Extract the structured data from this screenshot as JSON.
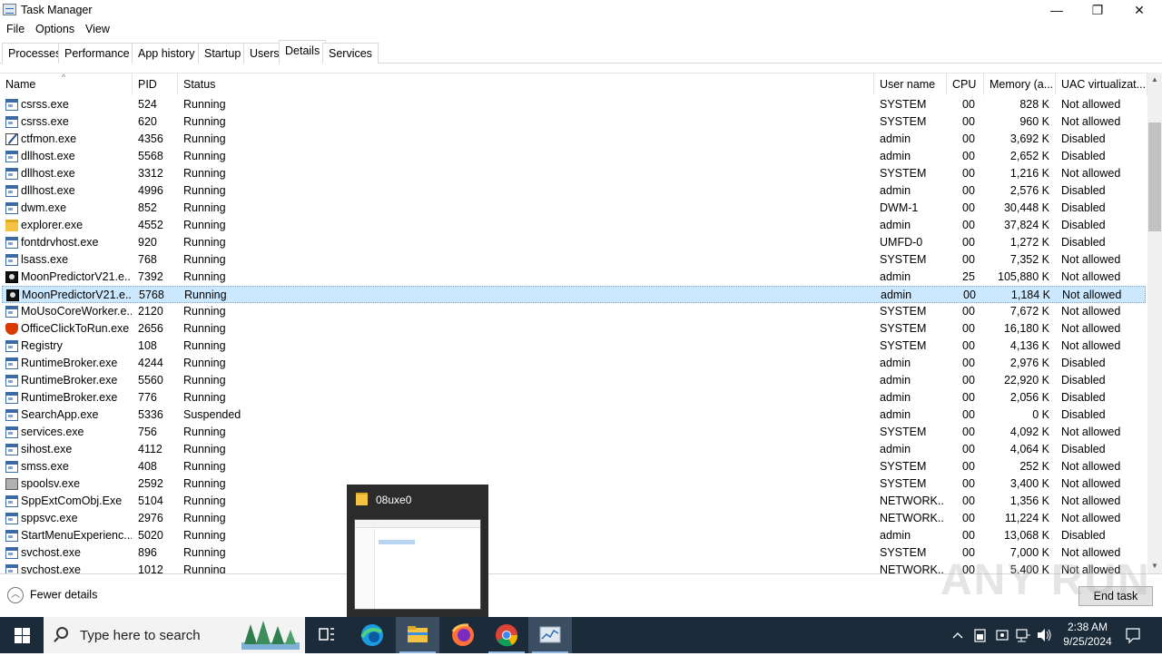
{
  "window": {
    "title": "Task Manager",
    "controls": {
      "minimize": "—",
      "maximize": "❐",
      "close": "✕"
    }
  },
  "menu": [
    "File",
    "Options",
    "View"
  ],
  "tabs": [
    "Processes",
    "Performance",
    "App history",
    "Startup",
    "Users",
    "Details",
    "Services"
  ],
  "active_tab": "Details",
  "columns": [
    "Name",
    "PID",
    "Status",
    "User name",
    "CPU",
    "Memory (a...",
    "UAC virtualizat..."
  ],
  "rows": [
    {
      "icon": "std",
      "name": "csrss.exe",
      "pid": "524",
      "status": "Running",
      "user": "SYSTEM",
      "cpu": "00",
      "mem": "828 K",
      "uac": "Not allowed"
    },
    {
      "icon": "std",
      "name": "csrss.exe",
      "pid": "620",
      "status": "Running",
      "user": "SYSTEM",
      "cpu": "00",
      "mem": "960 K",
      "uac": "Not allowed"
    },
    {
      "icon": "pen",
      "name": "ctfmon.exe",
      "pid": "4356",
      "status": "Running",
      "user": "admin",
      "cpu": "00",
      "mem": "3,692 K",
      "uac": "Disabled"
    },
    {
      "icon": "std",
      "name": "dllhost.exe",
      "pid": "5568",
      "status": "Running",
      "user": "admin",
      "cpu": "00",
      "mem": "2,652 K",
      "uac": "Disabled"
    },
    {
      "icon": "std",
      "name": "dllhost.exe",
      "pid": "3312",
      "status": "Running",
      "user": "SYSTEM",
      "cpu": "00",
      "mem": "1,216 K",
      "uac": "Not allowed"
    },
    {
      "icon": "std",
      "name": "dllhost.exe",
      "pid": "4996",
      "status": "Running",
      "user": "admin",
      "cpu": "00",
      "mem": "2,576 K",
      "uac": "Disabled"
    },
    {
      "icon": "std",
      "name": "dwm.exe",
      "pid": "852",
      "status": "Running",
      "user": "DWM-1",
      "cpu": "00",
      "mem": "30,448 K",
      "uac": "Disabled"
    },
    {
      "icon": "folder",
      "name": "explorer.exe",
      "pid": "4552",
      "status": "Running",
      "user": "admin",
      "cpu": "00",
      "mem": "37,824 K",
      "uac": "Disabled"
    },
    {
      "icon": "std",
      "name": "fontdrvhost.exe",
      "pid": "920",
      "status": "Running",
      "user": "UMFD-0",
      "cpu": "00",
      "mem": "1,272 K",
      "uac": "Disabled"
    },
    {
      "icon": "std",
      "name": "lsass.exe",
      "pid": "768",
      "status": "Running",
      "user": "SYSTEM",
      "cpu": "00",
      "mem": "7,352 K",
      "uac": "Not allowed"
    },
    {
      "icon": "moon",
      "name": "MoonPredictorV21.e...",
      "pid": "7392",
      "status": "Running",
      "user": "admin",
      "cpu": "25",
      "mem": "105,880 K",
      "uac": "Not allowed"
    },
    {
      "icon": "moon",
      "name": "MoonPredictorV21.e...",
      "pid": "5768",
      "status": "Running",
      "user": "admin",
      "cpu": "00",
      "mem": "1,184 K",
      "uac": "Not allowed",
      "selected": true
    },
    {
      "icon": "std",
      "name": "MoUsoCoreWorker.e...",
      "pid": "2120",
      "status": "Running",
      "user": "SYSTEM",
      "cpu": "00",
      "mem": "7,672 K",
      "uac": "Not allowed"
    },
    {
      "icon": "office",
      "name": "OfficeClickToRun.exe",
      "pid": "2656",
      "status": "Running",
      "user": "SYSTEM",
      "cpu": "00",
      "mem": "16,180 K",
      "uac": "Not allowed"
    },
    {
      "icon": "std",
      "name": "Registry",
      "pid": "108",
      "status": "Running",
      "user": "SYSTEM",
      "cpu": "00",
      "mem": "4,136 K",
      "uac": "Not allowed"
    },
    {
      "icon": "std",
      "name": "RuntimeBroker.exe",
      "pid": "4244",
      "status": "Running",
      "user": "admin",
      "cpu": "00",
      "mem": "2,976 K",
      "uac": "Disabled"
    },
    {
      "icon": "std",
      "name": "RuntimeBroker.exe",
      "pid": "5560",
      "status": "Running",
      "user": "admin",
      "cpu": "00",
      "mem": "22,920 K",
      "uac": "Disabled"
    },
    {
      "icon": "std",
      "name": "RuntimeBroker.exe",
      "pid": "776",
      "status": "Running",
      "user": "admin",
      "cpu": "00",
      "mem": "2,056 K",
      "uac": "Disabled"
    },
    {
      "icon": "std",
      "name": "SearchApp.exe",
      "pid": "5336",
      "status": "Suspended",
      "user": "admin",
      "cpu": "00",
      "mem": "0 K",
      "uac": "Disabled"
    },
    {
      "icon": "std",
      "name": "services.exe",
      "pid": "756",
      "status": "Running",
      "user": "SYSTEM",
      "cpu": "00",
      "mem": "4,092 K",
      "uac": "Not allowed"
    },
    {
      "icon": "std",
      "name": "sihost.exe",
      "pid": "4112",
      "status": "Running",
      "user": "admin",
      "cpu": "00",
      "mem": "4,064 K",
      "uac": "Disabled"
    },
    {
      "icon": "std",
      "name": "smss.exe",
      "pid": "408",
      "status": "Running",
      "user": "SYSTEM",
      "cpu": "00",
      "mem": "252 K",
      "uac": "Not allowed"
    },
    {
      "icon": "printer",
      "name": "spoolsv.exe",
      "pid": "2592",
      "status": "Running",
      "user": "SYSTEM",
      "cpu": "00",
      "mem": "3,400 K",
      "uac": "Not allowed"
    },
    {
      "icon": "std",
      "name": "SppExtComObj.Exe",
      "pid": "5104",
      "status": "Running",
      "user": "NETWORK...",
      "cpu": "00",
      "mem": "1,356 K",
      "uac": "Not allowed"
    },
    {
      "icon": "std",
      "name": "sppsvc.exe",
      "pid": "2976",
      "status": "Running",
      "user": "NETWORK...",
      "cpu": "00",
      "mem": "11,224 K",
      "uac": "Not allowed"
    },
    {
      "icon": "std",
      "name": "StartMenuExperienc...",
      "pid": "5020",
      "status": "Running",
      "user": "admin",
      "cpu": "00",
      "mem": "13,068 K",
      "uac": "Disabled"
    },
    {
      "icon": "std",
      "name": "svchost.exe",
      "pid": "896",
      "status": "Running",
      "user": "SYSTEM",
      "cpu": "00",
      "mem": "7,000 K",
      "uac": "Not allowed"
    },
    {
      "icon": "std",
      "name": "svchost.exe",
      "pid": "1012",
      "status": "Running",
      "user": "NETWORK...",
      "cpu": "00",
      "mem": "5,400 K",
      "uac": "Not allowed"
    }
  ],
  "footer": {
    "fewer_details": "Fewer details",
    "end_task": "End task"
  },
  "watermark": "ANY RUN",
  "preview": {
    "title": "08uxe0"
  },
  "taskbar": {
    "search_placeholder": "Type here to search",
    "time": "2:38 AM",
    "date": "9/25/2024"
  }
}
